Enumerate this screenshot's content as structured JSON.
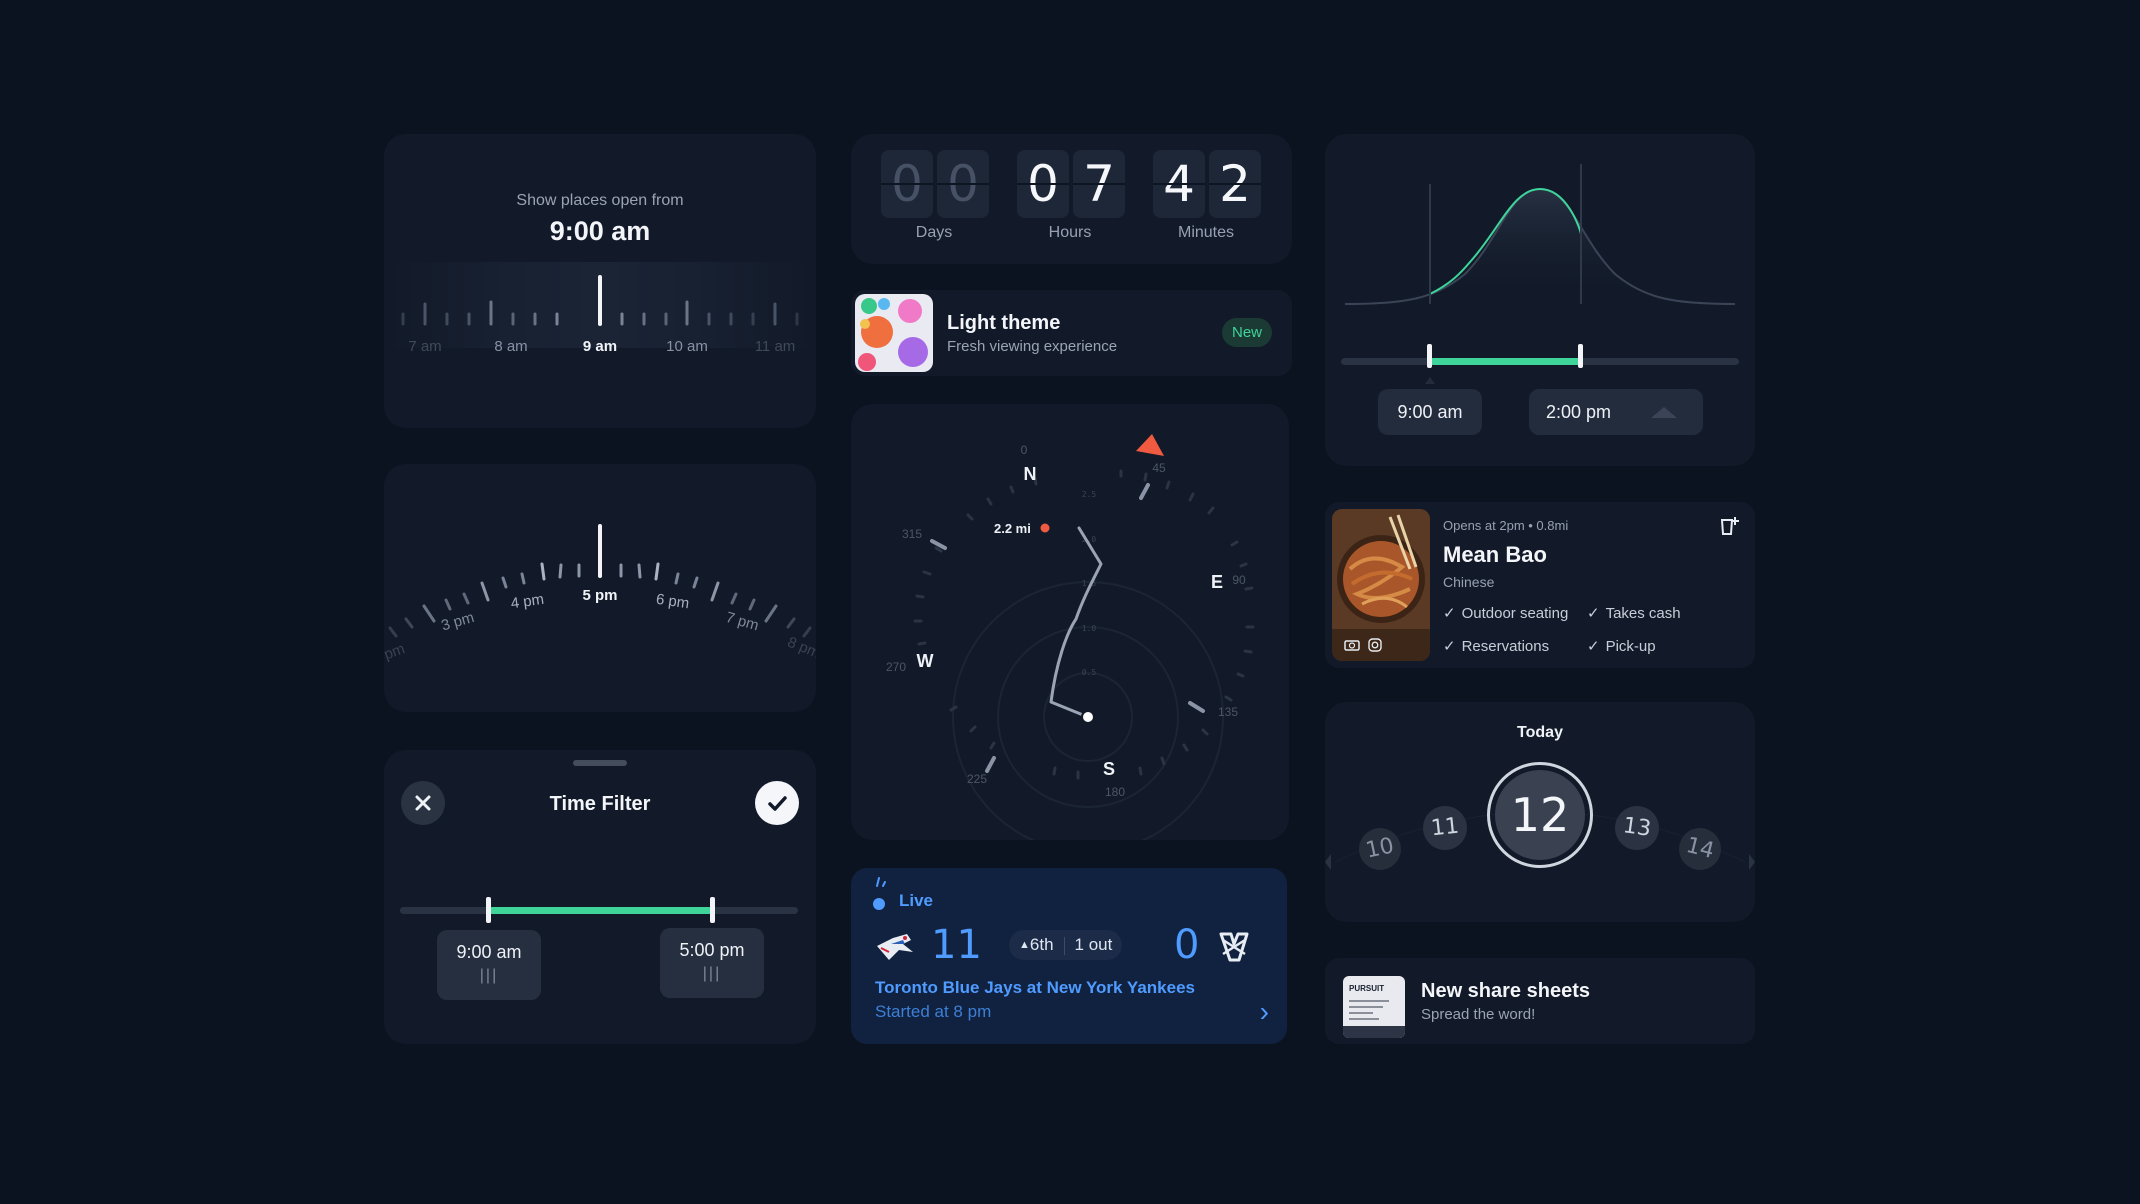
{
  "time_ruler": {
    "subtitle": "Show places open from",
    "selected_time": "9:00 am",
    "ticks": [
      "7 am",
      "8 am",
      "9 am",
      "10 am",
      "11 am"
    ]
  },
  "countdown": {
    "days": [
      "0",
      "0"
    ],
    "hours": [
      "0",
      "7"
    ],
    "minutes": [
      "4",
      "2"
    ],
    "labels": {
      "days": "Days",
      "hours": "Hours",
      "minutes": "Minutes"
    }
  },
  "light_theme": {
    "title": "Light theme",
    "subtitle": "Fresh viewing experience",
    "badge": "New"
  },
  "time_window": {
    "start": "9:00 am",
    "end": "2:00 pm",
    "accent": "#3fd49a"
  },
  "arc_dial": {
    "ticks": [
      "pm",
      "3 pm",
      "4 pm",
      "5 pm",
      "6 pm",
      "7 pm",
      "8 pm"
    ],
    "selected": "5 pm"
  },
  "compass": {
    "cardinals": {
      "n": "N",
      "e": "E",
      "s": "S",
      "w": "W"
    },
    "degrees": {
      "d0": "0",
      "d45": "45",
      "d90": "90",
      "d135": "135",
      "d180": "180",
      "d225": "225",
      "d270": "270",
      "d315": "315"
    },
    "rings": [
      "2.5",
      "2.0",
      "1.5",
      "1.0",
      "0.5"
    ],
    "distance": "2.2 mi",
    "route_color": "#f05a41"
  },
  "restaurant": {
    "meta": "Opens at 2pm • 0.8mi",
    "name": "Mean Bao",
    "cuisine": "Chinese",
    "features": [
      "Outdoor seating",
      "Takes cash",
      "Reservations",
      "Pick-up"
    ]
  },
  "date_picker": {
    "heading": "Today",
    "days": [
      "10",
      "11",
      "12",
      "13",
      "14"
    ],
    "selected": "12"
  },
  "share_sheets": {
    "title": "New share sheets",
    "subtitle": "Spread the word!",
    "thumb_label": "PURSUIT"
  },
  "time_filter": {
    "title": "Time Filter",
    "start": "9:00 am",
    "end": "5:00 pm",
    "grip": "|||",
    "accent": "#3fd49a"
  },
  "live_game": {
    "status": "Live",
    "home_score": "11",
    "away_score": "0",
    "inning": "6th",
    "outs": "1 out",
    "matchup": "Toronto Blue Jays at New York Yankees",
    "start": "Started at 8 pm",
    "accent": "#4f9bff"
  }
}
